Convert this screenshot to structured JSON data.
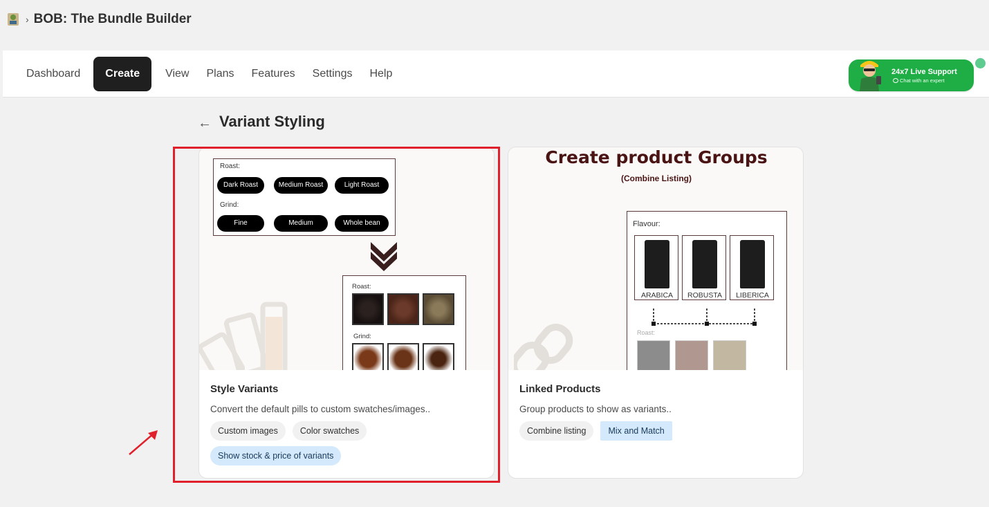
{
  "app": {
    "title": "BOB: The Bundle Builder",
    "crumb_separator": "›",
    "icon": "app-logo-icon"
  },
  "nav": {
    "items": [
      {
        "label": "Dashboard",
        "active": false
      },
      {
        "label": "Create",
        "active": true
      },
      {
        "label": "View",
        "active": false
      },
      {
        "label": "Plans",
        "active": false
      },
      {
        "label": "Features",
        "active": false
      },
      {
        "label": "Settings",
        "active": false
      },
      {
        "label": "Help",
        "active": false
      }
    ]
  },
  "support": {
    "title": "24x7 Live Support",
    "subtitle": "Chat with an expert",
    "icon": "chat-bubble-icon",
    "color": "#1fae45"
  },
  "page": {
    "back_icon": "←",
    "title": "Variant Styling"
  },
  "cards": [
    {
      "title": "Style Variants",
      "description": "Convert the default pills to custom swatches/images..",
      "tags": [
        "Custom images",
        "Color swatches",
        "Show stock & price of variants"
      ],
      "illustration": {
        "roast_label": "Roast:",
        "roast_pills": [
          "Dark Roast",
          "Medium Roast",
          "Light Roast"
        ],
        "grind_label": "Grind:",
        "grind_pills": [
          "Fine",
          "Medium",
          "Whole bean"
        ],
        "swatch_roast_label": "Roast:",
        "swatch_grind_label": "Grind:"
      }
    },
    {
      "title": "Linked Products",
      "description": "Group products to show as variants..",
      "tags": [
        "Combine listing",
        "Mix and Match"
      ],
      "illustration": {
        "heading": "Create product Groups",
        "subheading": "(Combine Listing)",
        "flavour_label": "Flavour:",
        "products": [
          "ARABICA",
          "ROBUSTA",
          "LIBERICA"
        ],
        "roast_label": "Roast:"
      }
    }
  ],
  "colors": {
    "highlight": "#e0202a",
    "active_nav": "#1f1f1f",
    "tag_blue": "#d4e9fb"
  }
}
